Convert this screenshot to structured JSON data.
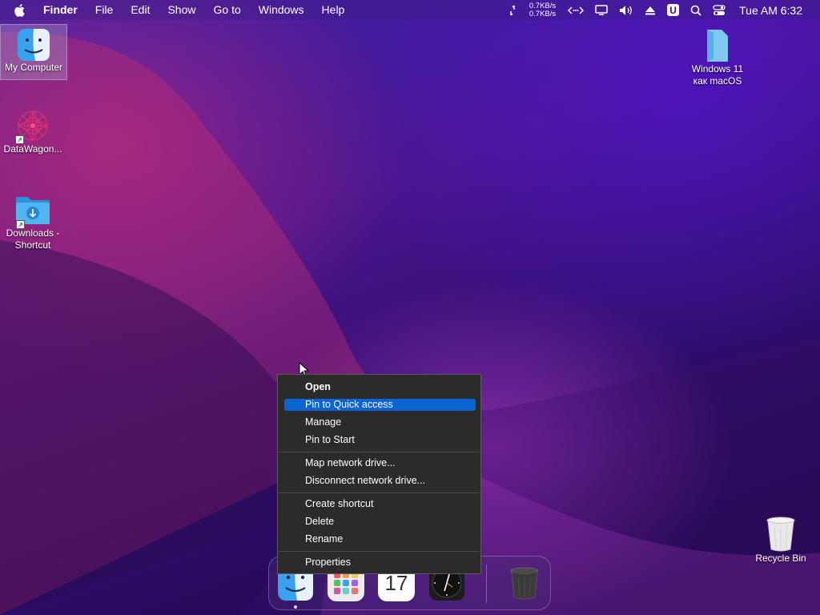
{
  "menubar": {
    "app_name": "Finder",
    "menus": [
      "File",
      "Edit",
      "Show",
      "Go to",
      "Windows",
      "Help"
    ],
    "net_up": "0.7KB/s",
    "net_down": "0.7KB/s",
    "u_badge": "U",
    "clock": "Tue AM 6:32"
  },
  "desktop": {
    "icons": [
      {
        "label": "My Computer"
      },
      {
        "label": "DataWagon..."
      },
      {
        "label_line1": "Downloads -",
        "label_line2": "Shortcut"
      },
      {
        "label_line1": "Windows 11",
        "label_line2": "как macOS"
      },
      {
        "label": "Recycle Bin"
      }
    ]
  },
  "context_menu": {
    "items": [
      {
        "label": "Open",
        "bold": true
      },
      {
        "label": "Pin to Quick access",
        "highlighted": true
      },
      {
        "label": "Manage"
      },
      {
        "label": "Pin to Start"
      },
      {
        "label": "Map network drive..."
      },
      {
        "label": "Disconnect network drive..."
      },
      {
        "label": "Create shortcut"
      },
      {
        "label": "Delete"
      },
      {
        "label": "Rename"
      },
      {
        "label": "Properties"
      }
    ]
  },
  "dock": {
    "apps": [
      {
        "icon": "finder-icon"
      },
      {
        "icon": "launchpad-icon"
      },
      {
        "icon": "calendar-icon",
        "text": "17"
      },
      {
        "icon": "clock-icon"
      },
      {
        "icon": "trash-icon"
      }
    ]
  },
  "colors": {
    "highlight": "#0a64d2",
    "menu_bg": "#2b2b2b"
  }
}
